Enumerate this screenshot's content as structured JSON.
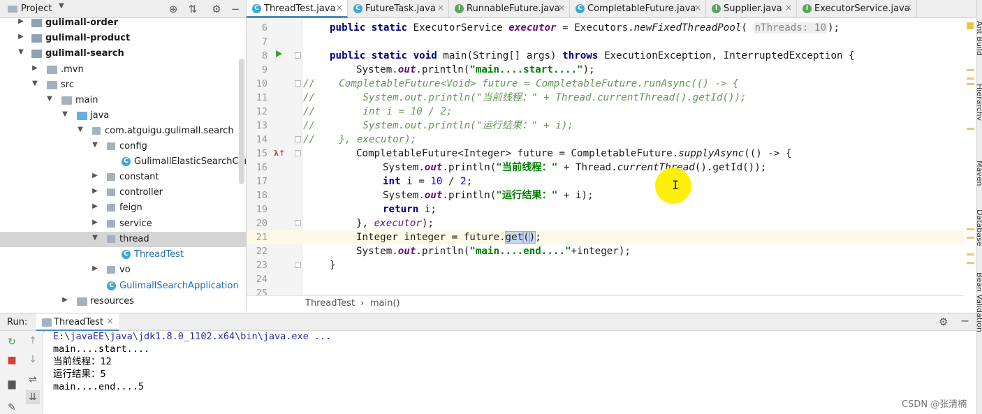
{
  "project": {
    "title": "Project",
    "tree": [
      {
        "label": "gulimall-order",
        "bold": true
      },
      {
        "label": "gulimall-product",
        "bold": true
      },
      {
        "label": "gulimall-search",
        "bold": true
      },
      {
        "label": ".mvn"
      },
      {
        "label": "src"
      },
      {
        "label": "main"
      },
      {
        "label": "java"
      },
      {
        "label": "com.atguigu.gulimall.search"
      },
      {
        "label": "config"
      },
      {
        "label": "GulimallElasticSearchConfig"
      },
      {
        "label": "constant"
      },
      {
        "label": "controller"
      },
      {
        "label": "feign"
      },
      {
        "label": "service"
      },
      {
        "label": "thread"
      },
      {
        "label": "ThreadTest"
      },
      {
        "label": "vo"
      },
      {
        "label": "GulimallSearchApplication"
      },
      {
        "label": "resources"
      }
    ]
  },
  "tabs": [
    {
      "label": "ThreadTest.java",
      "icon": "C",
      "active": true
    },
    {
      "label": "FutureTask.java",
      "icon": "C"
    },
    {
      "label": "RunnableFuture.java",
      "icon": "I"
    },
    {
      "label": "CompletableFuture.java",
      "icon": "C"
    },
    {
      "label": "Supplier.java",
      "icon": "I"
    },
    {
      "label": "ExecutorService.java",
      "icon": "I"
    }
  ],
  "editor": {
    "line_numbers": [
      "6",
      "7",
      "8",
      "9",
      "10",
      "11",
      "12",
      "13",
      "14",
      "15",
      "16",
      "17",
      "18",
      "19",
      "20",
      "21",
      "22",
      "23",
      "24",
      "25"
    ],
    "hint_nthreads": "nThreads: 10",
    "code": {
      "l6a": "public static ",
      "l6b": "ExecutorService ",
      "l6c": "executor",
      "l6d": " = Executors.",
      "l6e": "newFixedThreadPool",
      "l6f": "( ",
      "l6g": ");",
      "l8a": "public static void ",
      "l8b": "main(String[] args) ",
      "l8c": "throws ",
      "l8d": "ExecutionException, InterruptedException {",
      "l9a": "System.",
      "l9b": "out",
      "l9c": ".println(",
      "l9d": "\"main....start....\"",
      "l9e": ");",
      "l10": "//    CompletableFuture<Void> future = CompletableFuture.runAsync(() -> {",
      "l11": "//        System.out.println(\"当前线程：\" + Thread.currentThread().getId());",
      "l12": "//        int i = 10 / 2;",
      "l13": "//        System.out.println(\"运行结果：\" + i);",
      "l14": "//    }, executor);",
      "l15a": "CompletableFuture<Integer> future = CompletableFuture.",
      "l15b": "supplyAsync",
      "l15c": "(() -> {",
      "l16a": "System.",
      "l16b": "out",
      "l16c": ".println(",
      "l16d": "\"当前线程：\"",
      "l16e": " + Thread.",
      "l16f": "currentThread",
      "l16g": "().getId());",
      "l17a": "int ",
      "l17b": "i = ",
      "l17c": "10",
      "l17d": " / ",
      "l17e": "2",
      "l17f": ";",
      "l18a": "System.",
      "l18b": "out",
      "l18c": ".println(",
      "l18d": "\"运行结果：\"",
      "l18e": " + i);",
      "l19a": "return ",
      "l19b": "i;",
      "l20a": "}, ",
      "l20b": "executor",
      "l20c": ");",
      "l21a": "Integer integer = future.",
      "l21b": "get",
      "l21c": "(",
      "l21d": ")",
      "l21e": ";",
      "l22a": "System.",
      "l22b": "out",
      "l22c": ".println(",
      "l22d": "\"main....end....\"",
      "l22e": "+integer);",
      "l23": "}"
    }
  },
  "breadcrumb": {
    "class": "ThreadTest",
    "sep": "›",
    "method": "main()"
  },
  "run": {
    "label": "Run:",
    "tab": "ThreadTest",
    "console": [
      "E:\\javaEE\\java\\jdk1.8.0_1102.x64\\bin\\java.exe ...",
      "main....start....",
      "当前线程：12",
      "运行结果：5",
      "main....end....5"
    ]
  },
  "right_stripe": [
    "Ant Build",
    "Hierarchy",
    "Maven",
    "Database",
    "Bean Validation"
  ],
  "watermark": "CSDN @张清楠"
}
